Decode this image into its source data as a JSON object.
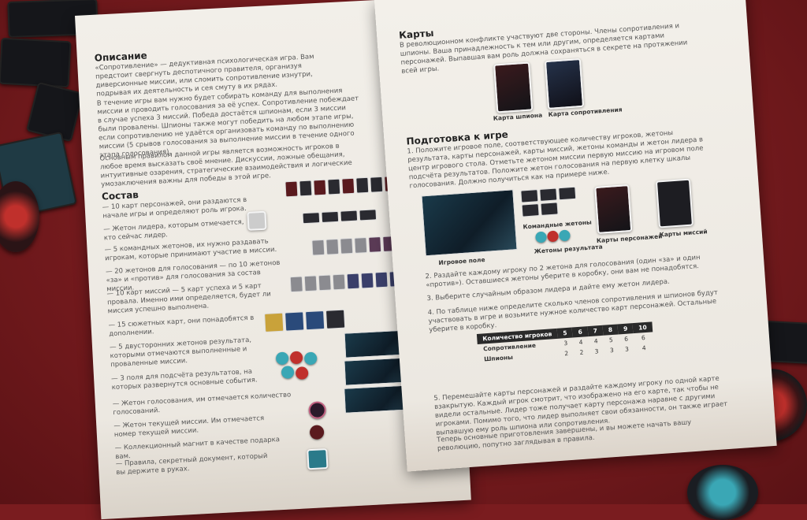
{
  "left_page": {
    "description_heading": "Описание",
    "description_text": "«Сопротивление» — дедуктивная психологическая игра. Вам предстоит свергнуть деспотичного правителя, организуя диверсионные миссии, или сломить сопротивление изнутри, подрывая их деятельность и сея смуту в их рядах.",
    "paragraph2": "В течение игры вам нужно будет собирать команду для выполнения миссии и проводить голосования за её успех. Сопротивление побеждает в случае успеха 3 миссий. Победа достаётся шпионам, если 3 миссии были провалены. Шпионы также могут победить на любом этапе игры, если сопротивлению не удаётся организовать команду по выполнению миссии (5 срывов голосования за выполнение миссии в течение одного этапа голосования).",
    "paragraph3": "Основным правилом данной игры является возможность игроков в любое время высказать своё мнение. Дискуссии, ложные обещания, интуитивные озарения, стратегические взаимодействия и логические умозаключения важны для победы в этой игре.",
    "components_heading": "Состав",
    "components": [
      "— 10 карт персонажей, они раздаются в начале игры и определяют роль игрока.",
      "— Жетон лидера, которым отмечается, кто сейчас лидер.",
      "— 5 командных жетонов, их нужно раздавать игрокам, которые принимают участие в миссии.",
      "— 20 жетонов для голосования — по 10 жетонов «за» и «против» для голосования за состав миссии.",
      "— 10 карт миссий — 5 карт успеха и 5 карт провала. Именно ими определяется, будет ли миссия успешно выполнена.",
      "— 15 сюжетных карт, они понадобятся в дополнении.",
      "— 5 двусторонних жетонов результата, которыми отмечаются выполненные и проваленные миссии.",
      "— 3 поля для подсчёта результатов, на которых развернутся основные события.",
      "— Жетон голосования, им отмечается количество голосований.",
      "— Жетон текущей миссии. Им отмечается номер текущей миссии.",
      "— Коллекционный магнит в качестве подарка вам.",
      "— Правила, секретный документ, который вы держите в руках."
    ]
  },
  "right_page": {
    "cards_heading": "Карты",
    "cards_text": "В революционном конфликте участвуют две стороны. Члены сопротивления и шпионы. Ваша принадлежность к тем или другим, определяется картами персонажей. Выпавшая вам роль должна сохраняться в секрете на протяжении всей игры.",
    "spy_card_label": "Карта шпиона",
    "resistance_card_label": "Карта сопротивления",
    "setup_heading": "Подготовка к игре",
    "setup_step1": "1. Положите игровое поле, соответствующее количеству игроков, жетоны результата, карты персонажей, карты миссий, жетоны команды и жетон лидера в центр игрового стола. Отметьте жетоном миссии первую миссию на игровом поле подсчёта результатов. Положите жетон голосования на первую клетку шкалы голосования. Должно получиться как на примере ниже.",
    "board_label": "Игровое поле",
    "team_tokens_label": "Командные жетоны",
    "result_tokens_label": "Жетоны результата",
    "character_cards_label": "Карты персонажей",
    "mission_cards_label": "Карты миссий",
    "setup_step2": "2. Раздайте каждому игроку по 2 жетона для голосования (один «за» и один «против»). Оставшиеся жетоны уберите в коробку, они вам не понадобятся.",
    "setup_step3": "3. Выберите случайным образом лидера и дайте ему жетон лидера.",
    "setup_step4": "4. По таблице ниже определите сколько членов сопротивления и шпионов будут участвовать в игре и возьмите нужное количество карт персонажей. Остальные уберите в коробку.",
    "table": {
      "header": [
        "Количество игроков",
        "5",
        "6",
        "7",
        "8",
        "9",
        "10"
      ],
      "rows": [
        [
          "Сопротивление",
          "3",
          "4",
          "4",
          "5",
          "6",
          "6"
        ],
        [
          "Шпионы",
          "2",
          "2",
          "3",
          "3",
          "3",
          "4"
        ]
      ]
    },
    "setup_step5": "5. Перемешайте карты персонажей и раздайте каждому игроку по одной карте взакрытую. Каждый игрок смотрит, что изображено на его карте, так чтобы не видели остальные. Лидер тоже получает карту персонажа наравне с другими игроками. Помимо того, что лидер выполняет свои обязанности, он также играет выпавшую ему роль шпиона или сопротивления.",
    "final_text": "Теперь основные приготовления завершены, и вы можете начать вашу революцию, попутно заглядывая в правила."
  },
  "colors": {
    "table": "#7a1c1f",
    "paper": "#efece6",
    "accent_red": "#c0302c",
    "accent_teal": "#3aa7b5"
  }
}
